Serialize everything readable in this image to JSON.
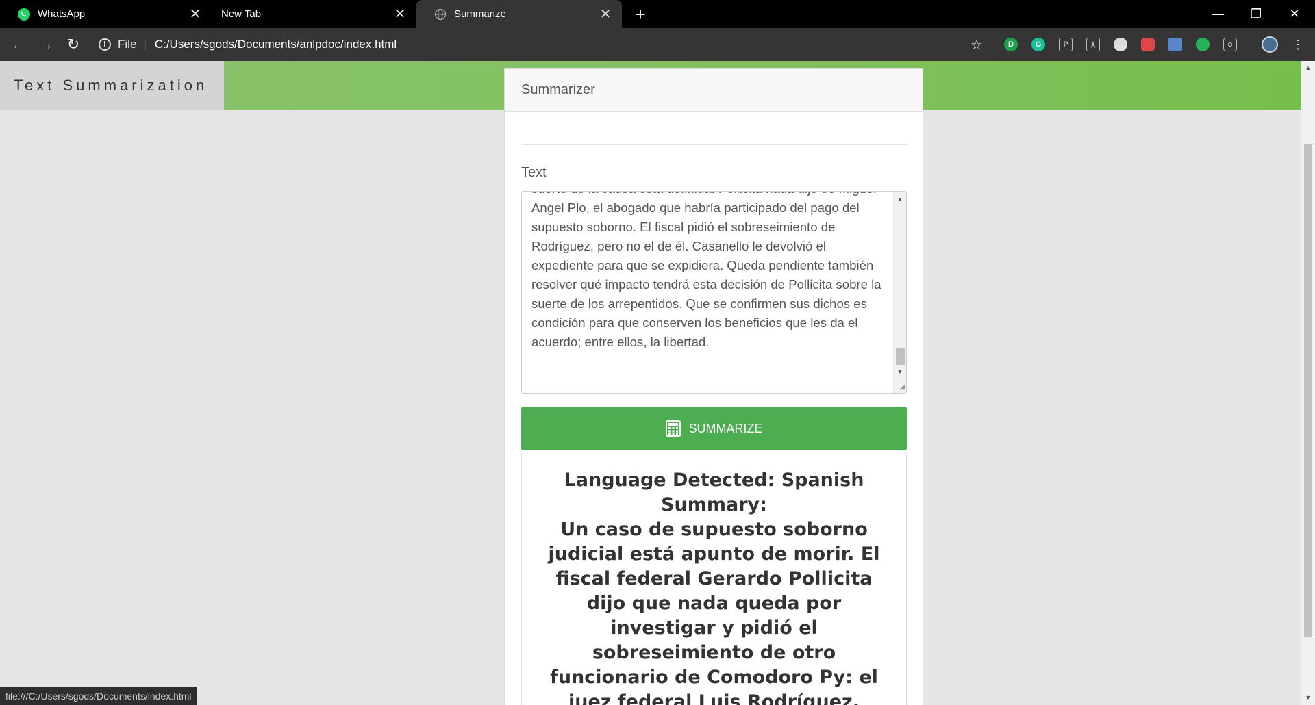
{
  "browser": {
    "tabs": [
      {
        "title": "WhatsApp",
        "icon": "whatsapp-icon"
      },
      {
        "title": "New Tab",
        "icon": ""
      },
      {
        "title": "Summarize",
        "icon": "globe-icon"
      }
    ],
    "url_scheme_label": "File",
    "url": "C:/Users/sgods/Documents/anlpdoc/index.html",
    "status_text": "file:///C:/Users/sgods/Documents/index.html"
  },
  "page": {
    "brand": "Text Summarization",
    "card_title": "Summarizer",
    "text_label": "Text",
    "text_value": "suerte de la causa está definida. Pollicita nada dijo de Miguel Angel Plo, el abogado que habría participado del pago del supuesto soborno. El fiscal pidió el sobreseimiento de Rodríguez, pero no el de él. Casanello le devolvió el expediente para que se expidiera. Queda pendiente también resolver qué impacto tendrá esta decisión de Pollicita sobre la suerte de los arrepentidos. Que se confirmen sus dichos es condición para que conserven los beneficios que les da el acuerdo; entre ellos, la libertad.",
    "summarize_button": "SUMMARIZE",
    "result": {
      "language_line": "Language Detected: Spanish",
      "summary_heading": "Summary:",
      "summary_text": "Un caso de supuesto soborno judicial está apunto de morir. El fiscal federal Gerardo Pollicita dijo que nada queda por investigar y pidió el sobreseimiento de otro funcionario de Comodoro Py: el juez federal Luis Rodríguez."
    }
  },
  "colors": {
    "banner_green": "#80c05e",
    "button_green": "#4cae50",
    "brand_bg": "#d4d4d4",
    "chrome_dark": "#353535"
  }
}
